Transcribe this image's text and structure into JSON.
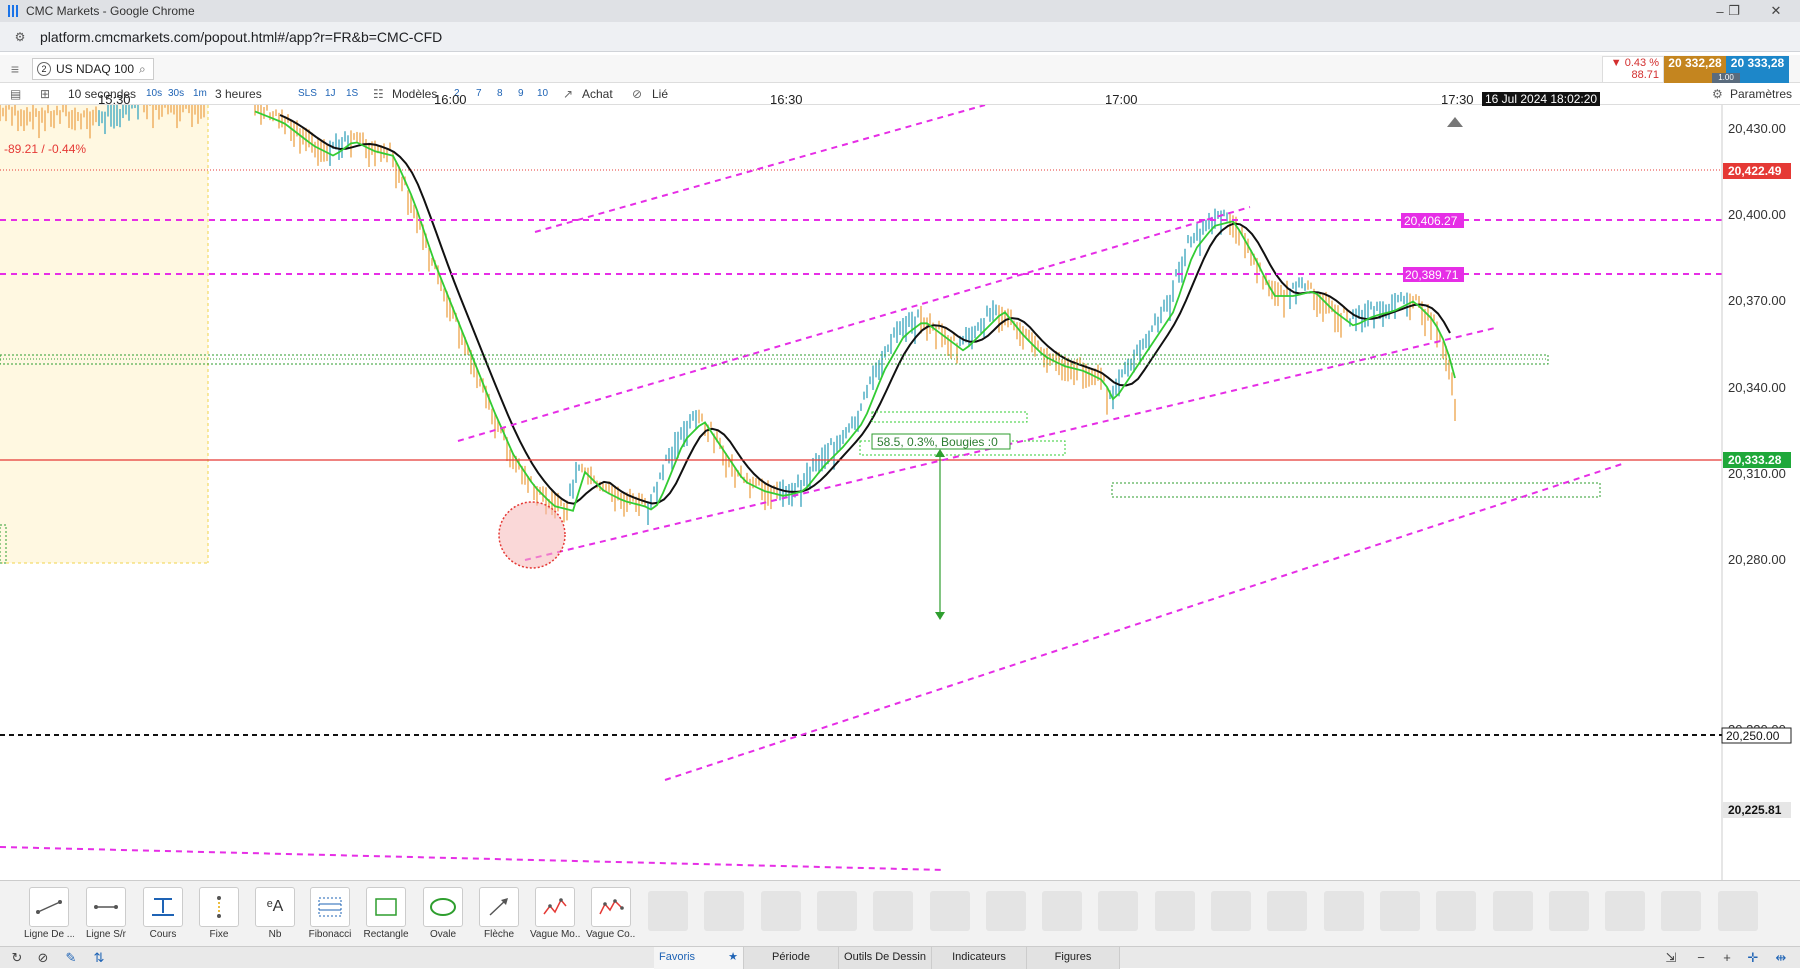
{
  "window": {
    "title": "CMC Markets - Google Chrome",
    "minimize": "–",
    "maximize": "❐",
    "close": "✕"
  },
  "browser": {
    "url": "platform.cmcmarkets.com/popout.html#/app?r=FR&b=CMC-CFD"
  },
  "instrument": {
    "badge": "2",
    "name": "US NDAQ 100",
    "change_pct": "▼ 0.43 %",
    "change_pts": "88.71",
    "sell": "20 332,28",
    "buy": "20 333,28",
    "spread": "1.00"
  },
  "toolbar": {
    "interval": "10 secondes",
    "int_10s": "10s",
    "int_30s": "30s",
    "int_1m": "1m",
    "range": "3 heures",
    "sls": "SLS",
    "r1j": "1J",
    "r1s": "1S",
    "templates": "Modèles",
    "n2": "2",
    "n7": "7",
    "n8": "8",
    "n9": "9",
    "n10": "10",
    "side": "Achat",
    "linked": "Lié",
    "settings": "Paramètres"
  },
  "chart": {
    "time_labels": [
      "15:30",
      "16:00",
      "16:30",
      "17:00",
      "17:30"
    ],
    "crosshair_time": "16 Jul 2024 18:02:20",
    "price_ticks": [
      "20,430.00",
      "20,400.00",
      "20,370.00",
      "20,340.00",
      "20,310.00",
      "20,280.00",
      "20,220.00"
    ],
    "prev_close_label": "20,422.49",
    "current_price_label": "20,333.28",
    "dashed_level_label": "20,250.00",
    "low_label": "20,225.81",
    "level_upper": "20,406.27",
    "level_lower": "20,389.71",
    "change_text": "-89.21 / -0.44%",
    "measure_text": "58.5, 0.3%, Bougies :0",
    "colors": {
      "up": "#5bb4c8",
      "down": "#f0b46b",
      "magenta": "#e62ee6",
      "red_line": "#e53935",
      "green_label": "#1fa83a",
      "zone_green": "#2e9e2e",
      "ema_fast": "#33cc33",
      "ema_slow": "#111111"
    }
  },
  "tools": [
    {
      "label": "Ligne De ...",
      "icon": "trend-line-icon"
    },
    {
      "label": "Ligne S/r",
      "icon": "sr-line-icon"
    },
    {
      "label": "Cours",
      "icon": "price-line-icon"
    },
    {
      "label": "Fixe",
      "icon": "fixed-icon"
    },
    {
      "label": "Nb",
      "icon": "text-icon"
    },
    {
      "label": "Fibonacci",
      "icon": "fibonacci-icon"
    },
    {
      "label": "Rectangle",
      "icon": "rectangle-icon"
    },
    {
      "label": "Ovale",
      "icon": "oval-icon"
    },
    {
      "label": "Flèche",
      "icon": "arrow-icon"
    },
    {
      "label": "Vague Mo...",
      "icon": "wave-icon"
    },
    {
      "label": "Vague Co...",
      "icon": "wave-co-icon"
    }
  ],
  "tabs": {
    "favorites": "Favoris",
    "period": "Période",
    "drawing_tools": "Outils De Dessin",
    "indicators": "Indicateurs",
    "figures": "Figures"
  }
}
